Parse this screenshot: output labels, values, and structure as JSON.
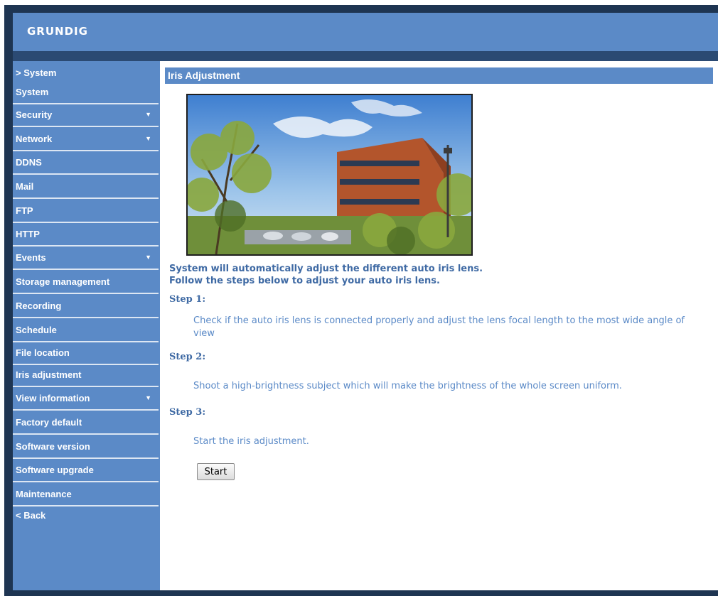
{
  "header": {
    "logo": "GRUNDIG"
  },
  "sidebar": {
    "section": "> System",
    "items": [
      {
        "label": "System",
        "dropdown": false
      },
      {
        "label": "Security",
        "dropdown": true
      },
      {
        "label": "Network",
        "dropdown": true
      },
      {
        "label": "DDNS",
        "dropdown": false
      },
      {
        "label": "Mail",
        "dropdown": false
      },
      {
        "label": "FTP",
        "dropdown": false
      },
      {
        "label": "HTTP",
        "dropdown": false
      },
      {
        "label": "Events",
        "dropdown": true
      },
      {
        "label": "Storage management",
        "dropdown": false
      },
      {
        "label": "Recording",
        "dropdown": false
      },
      {
        "label": "Schedule",
        "dropdown": false
      },
      {
        "label": "File location",
        "dropdown": false
      },
      {
        "label": "Iris adjustment",
        "dropdown": false
      },
      {
        "label": "View information",
        "dropdown": true
      },
      {
        "label": "Factory default",
        "dropdown": false
      },
      {
        "label": "Software version",
        "dropdown": false
      },
      {
        "label": "Software upgrade",
        "dropdown": false
      },
      {
        "label": "Maintenance",
        "dropdown": false
      }
    ],
    "back": "< Back",
    "dropdown_icon": "triangle-down-icon"
  },
  "main": {
    "title": "Iris Adjustment",
    "intro_line1": "System will automatically adjust the different auto iris lens.",
    "intro_line2": "Follow the steps below to adjust your auto iris lens.",
    "steps": [
      {
        "label": "Step 1:",
        "text": "Check if the auto iris lens is connected properly and adjust the lens focal length to the most wide angle of view"
      },
      {
        "label": "Step 2:",
        "text": "Shoot a high-brightness subject which will make the brightness of the whole screen uniform."
      },
      {
        "label": "Step 3:",
        "text": "Start the iris adjustment."
      }
    ],
    "start_button": "Start"
  },
  "colors": {
    "accent": "#5b8ac7",
    "frame_dark": "#1e3552",
    "text_blue": "#3f6aa4"
  }
}
